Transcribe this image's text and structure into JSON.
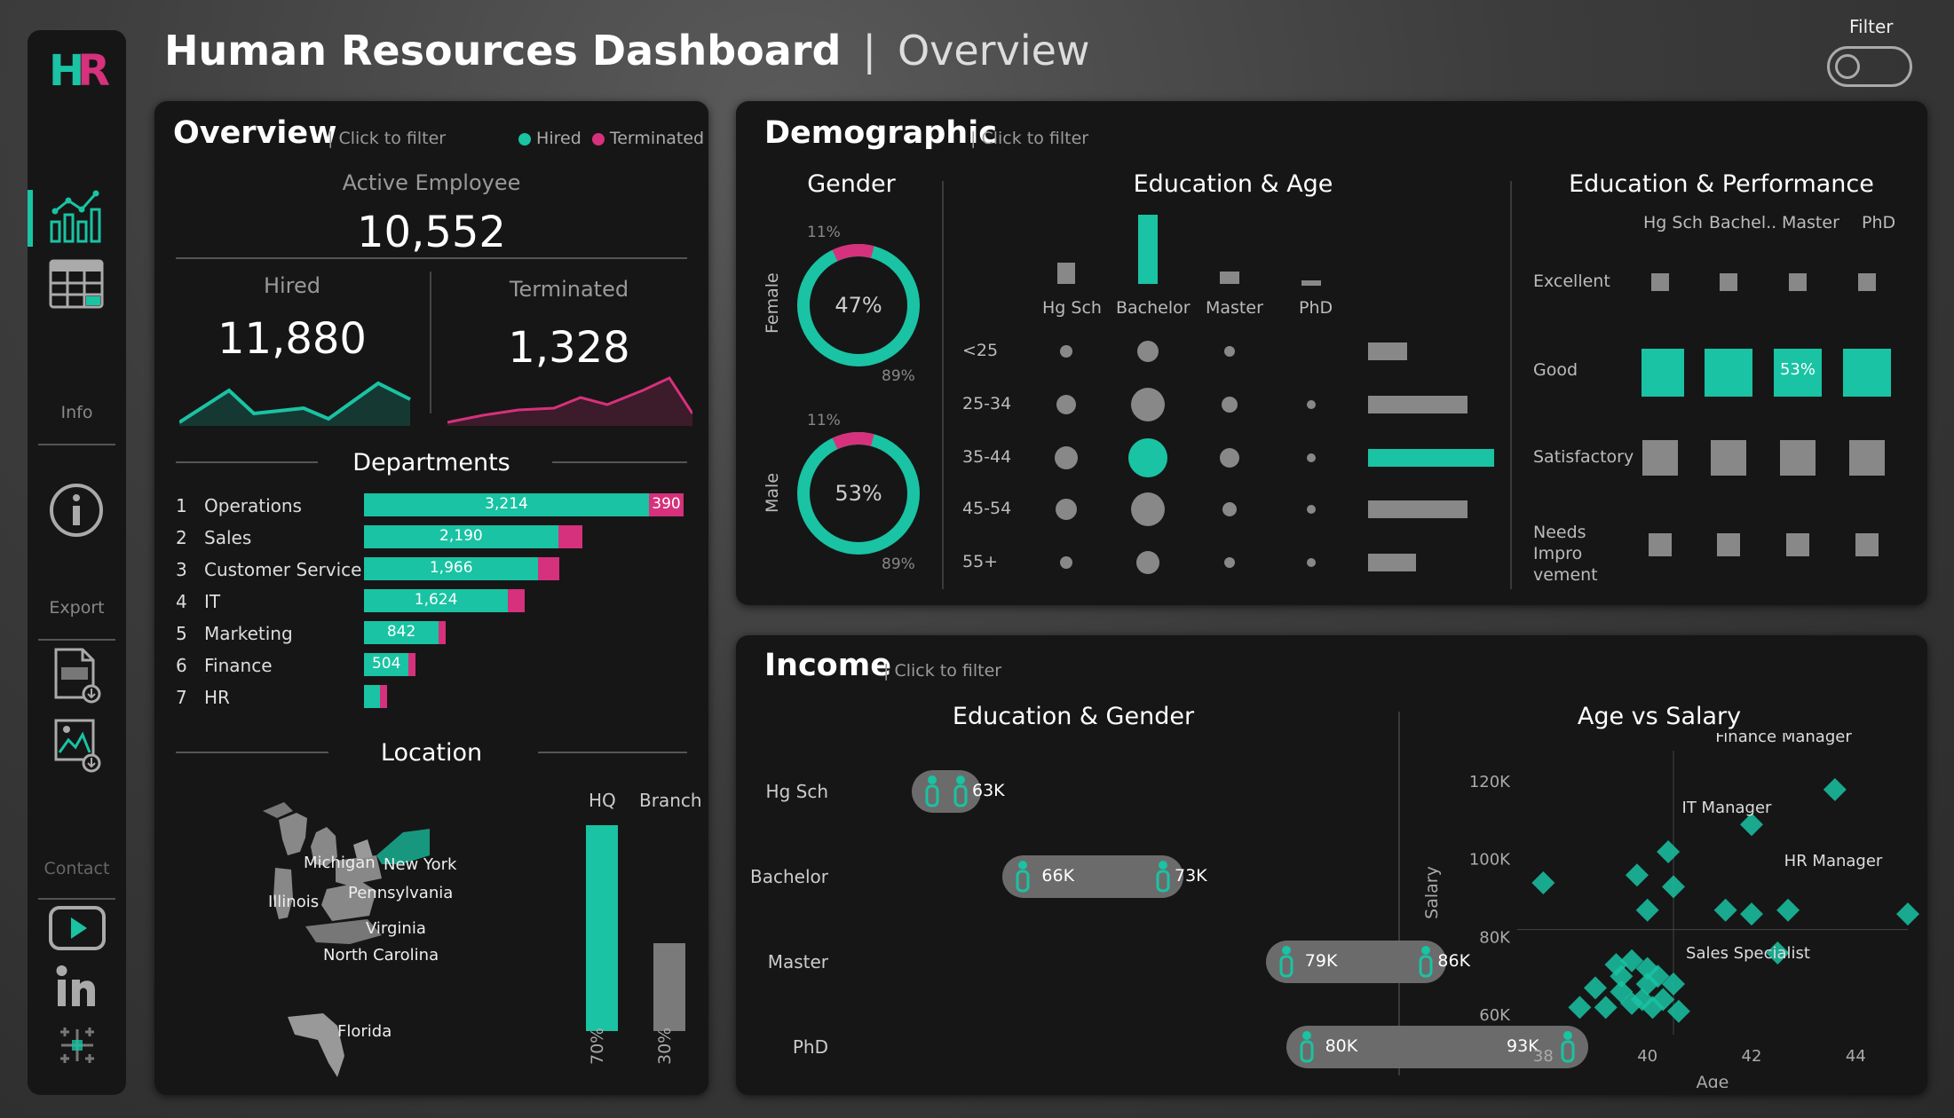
{
  "header": {
    "title": "Human Resources Dashboard",
    "separator": "|",
    "subtitle": "Overview",
    "filter_label": "Filter"
  },
  "sidebar": {
    "logo_h": "H",
    "logo_r": "R",
    "info_label": "Info",
    "export_label": "Export",
    "contact_label": "Contact"
  },
  "overview": {
    "title": "Overview",
    "click": "| Click to filter",
    "legend_hired": "Hired",
    "legend_terminated": "Terminated",
    "active_label": "Active Employee",
    "active_value": "10,552",
    "hired_label": "Hired",
    "hired_value": "11,880",
    "terminated_label": "Terminated",
    "terminated_value": "1,328",
    "departments_title": "Departments",
    "departments": [
      {
        "rank": "1",
        "name": "Operations",
        "hired": 3214,
        "label": "3,214",
        "terminated": 390,
        "term_label": "390"
      },
      {
        "rank": "2",
        "name": "Sales",
        "hired": 2190,
        "label": "2,190",
        "terminated": 270,
        "term_label": ""
      },
      {
        "rank": "3",
        "name": "Customer Service",
        "hired": 1966,
        "label": "1,966",
        "terminated": 240,
        "term_label": ""
      },
      {
        "rank": "4",
        "name": "IT",
        "hired": 1624,
        "label": "1,624",
        "terminated": 190,
        "term_label": ""
      },
      {
        "rank": "5",
        "name": "Marketing",
        "hired": 842,
        "label": "842",
        "terminated": 80,
        "term_label": ""
      },
      {
        "rank": "6",
        "name": "Finance",
        "hired": 504,
        "label": "504",
        "terminated": 60,
        "term_label": ""
      },
      {
        "rank": "7",
        "name": "HR",
        "hired": 180,
        "label": "",
        "terminated": 40,
        "term_label": ""
      }
    ],
    "location_title": "Location",
    "states": [
      "Michigan",
      "New York",
      "Illinois",
      "Pennsylvania",
      "Virginia",
      "North Carolina",
      "Florida"
    ],
    "hq_label": "HQ",
    "branch_label": "Branch",
    "hq_pct": "70%",
    "branch_pct": "30%",
    "hq_value": 0.7,
    "branch_value": 0.3
  },
  "demographic": {
    "title": "Demographic",
    "click": "| Click to filter",
    "gender_title": "Gender",
    "female": {
      "label": "Female",
      "center": "47%",
      "top": "11%",
      "bottom": "89%"
    },
    "male": {
      "label": "Male",
      "center": "53%",
      "top": "11%",
      "bottom": "89%"
    },
    "edu_age_title": "Education & Age",
    "edu_levels": [
      "Hg Sch",
      "Bachelor",
      "Master",
      "PhD"
    ],
    "age_groups": [
      "<25",
      "25-34",
      "35-44",
      "45-54",
      "55+"
    ],
    "edu_perf_title": "Education & Performance",
    "perf_cols": [
      "Hg Sch",
      "Bachel..",
      "Master",
      "PhD"
    ],
    "perf_rows": [
      "Excellent",
      "Good",
      "Satisfactory",
      "Needs Impro vement"
    ],
    "perf_highlight": "53%"
  },
  "income": {
    "title": "Income",
    "click": "| Click to filter",
    "edu_gender_title": "Education & Gender",
    "rows": [
      {
        "edu": "Hg Sch",
        "low": "",
        "high": "63K"
      },
      {
        "edu": "Bachelor",
        "low": "66K",
        "high": "73K"
      },
      {
        "edu": "Master",
        "low": "79K",
        "high": "86K"
      },
      {
        "edu": "PhD",
        "low": "80K",
        "high": "93K"
      }
    ],
    "age_salary_title": "Age vs Salary"
  },
  "chart_data": {
    "type": "scatter",
    "title": "Age vs Salary",
    "xlabel": "Age",
    "ylabel": "Salary",
    "x_ticks": [
      "38",
      "40",
      "42",
      "44"
    ],
    "y_ticks": [
      "60K",
      "80K",
      "100K",
      "120K"
    ],
    "xlim": [
      37.5,
      45
    ],
    "ylim": [
      55000,
      128000
    ],
    "points": [
      {
        "x": 38.0,
        "y": 94000
      },
      {
        "x": 39.8,
        "y": 96000
      },
      {
        "x": 40.4,
        "y": 102000
      },
      {
        "x": 40.5,
        "y": 93000
      },
      {
        "x": 40.0,
        "y": 87000
      },
      {
        "x": 42.0,
        "y": 109000
      },
      {
        "x": 43.6,
        "y": 118000
      },
      {
        "x": 41.5,
        "y": 87000
      },
      {
        "x": 42.0,
        "y": 86000
      },
      {
        "x": 42.7,
        "y": 87000
      },
      {
        "x": 45.0,
        "y": 86000
      },
      {
        "x": 42.5,
        "y": 76000
      },
      {
        "x": 39.4,
        "y": 73000
      },
      {
        "x": 39.7,
        "y": 74000
      },
      {
        "x": 40.0,
        "y": 72000
      },
      {
        "x": 40.2,
        "y": 70000
      },
      {
        "x": 40.5,
        "y": 68000
      },
      {
        "x": 39.0,
        "y": 67000
      },
      {
        "x": 39.5,
        "y": 66000
      },
      {
        "x": 39.9,
        "y": 64000
      },
      {
        "x": 40.3,
        "y": 64000
      },
      {
        "x": 38.7,
        "y": 62000
      },
      {
        "x": 39.2,
        "y": 62000
      },
      {
        "x": 39.7,
        "y": 63000
      },
      {
        "x": 40.1,
        "y": 62000
      },
      {
        "x": 40.6,
        "y": 61000
      },
      {
        "x": 40.0,
        "y": 68000
      },
      {
        "x": 39.5,
        "y": 70000
      }
    ],
    "annotations": [
      "Finance Manager",
      "IT Manager",
      "HR Manager",
      "Sales Specialist"
    ]
  }
}
